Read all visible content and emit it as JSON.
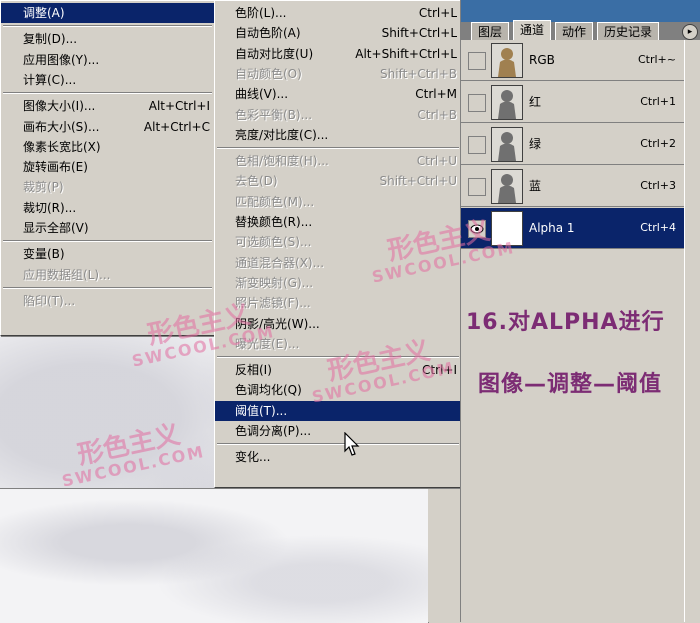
{
  "menu1": {
    "items": [
      {
        "label": "调整(A)",
        "shortcut": "",
        "disabled": false,
        "highlighted": true
      },
      {
        "sep": true
      },
      {
        "label": "复制(D)...",
        "shortcut": "",
        "disabled": false
      },
      {
        "label": "应用图像(Y)...",
        "shortcut": "",
        "disabled": false
      },
      {
        "label": "计算(C)...",
        "shortcut": "",
        "disabled": false
      },
      {
        "sep": true
      },
      {
        "label": "图像大小(I)...",
        "shortcut": "Alt+Ctrl+I",
        "disabled": false
      },
      {
        "label": "画布大小(S)...",
        "shortcut": "Alt+Ctrl+C",
        "disabled": false
      },
      {
        "label": "像素长宽比(X)",
        "shortcut": "",
        "disabled": false
      },
      {
        "label": "旋转画布(E)",
        "shortcut": "",
        "disabled": false
      },
      {
        "label": "裁剪(P)",
        "shortcut": "",
        "disabled": true
      },
      {
        "label": "裁切(R)...",
        "shortcut": "",
        "disabled": false
      },
      {
        "label": "显示全部(V)",
        "shortcut": "",
        "disabled": false
      },
      {
        "sep": true
      },
      {
        "label": "变量(B)",
        "shortcut": "",
        "disabled": false
      },
      {
        "label": "应用数据组(L)...",
        "shortcut": "",
        "disabled": true
      },
      {
        "sep": true
      },
      {
        "label": "陷印(T)...",
        "shortcut": "",
        "disabled": true
      }
    ]
  },
  "menu2": {
    "items": [
      {
        "label": "色阶(L)...",
        "shortcut": "Ctrl+L",
        "disabled": false
      },
      {
        "label": "自动色阶(A)",
        "shortcut": "Shift+Ctrl+L",
        "disabled": false
      },
      {
        "label": "自动对比度(U)",
        "shortcut": "Alt+Shift+Ctrl+L",
        "disabled": false
      },
      {
        "label": "自动颜色(O)",
        "shortcut": "Shift+Ctrl+B",
        "disabled": true
      },
      {
        "label": "曲线(V)...",
        "shortcut": "Ctrl+M",
        "disabled": false
      },
      {
        "label": "色彩平衡(B)...",
        "shortcut": "Ctrl+B",
        "disabled": true
      },
      {
        "label": "亮度/对比度(C)...",
        "shortcut": "",
        "disabled": false
      },
      {
        "sep": true
      },
      {
        "label": "色相/饱和度(H)...",
        "shortcut": "Ctrl+U",
        "disabled": true
      },
      {
        "label": "去色(D)",
        "shortcut": "Shift+Ctrl+U",
        "disabled": true
      },
      {
        "label": "匹配颜色(M)...",
        "shortcut": "",
        "disabled": true
      },
      {
        "label": "替换颜色(R)...",
        "shortcut": "",
        "disabled": false
      },
      {
        "label": "可选颜色(S)...",
        "shortcut": "",
        "disabled": true
      },
      {
        "label": "通道混合器(X)...",
        "shortcut": "",
        "disabled": true
      },
      {
        "label": "渐变映射(G)...",
        "shortcut": "",
        "disabled": true
      },
      {
        "label": "照片滤镜(F)...",
        "shortcut": "",
        "disabled": true
      },
      {
        "label": "阴影/高光(W)...",
        "shortcut": "",
        "disabled": false
      },
      {
        "label": "曝光度(E)...",
        "shortcut": "",
        "disabled": true
      },
      {
        "sep": true
      },
      {
        "label": "反相(I)",
        "shortcut": "Ctrl+I",
        "disabled": false
      },
      {
        "label": "色调均化(Q)",
        "shortcut": "",
        "disabled": false
      },
      {
        "label": "阈值(T)...",
        "shortcut": "",
        "disabled": false,
        "highlighted": true
      },
      {
        "label": "色调分离(P)...",
        "shortcut": "",
        "disabled": false
      },
      {
        "sep": true
      },
      {
        "label": "变化...",
        "shortcut": "",
        "disabled": false
      }
    ]
  },
  "panel": {
    "tabs": [
      "图层",
      "通道",
      "动作",
      "历史记录"
    ],
    "active_tab": 1,
    "menu_icon": "▸",
    "channels": [
      {
        "name": "RGB",
        "shortcut": "Ctrl+~",
        "selected": false
      },
      {
        "name": "红",
        "shortcut": "Ctrl+1",
        "selected": false
      },
      {
        "name": "绿",
        "shortcut": "Ctrl+2",
        "selected": false
      },
      {
        "name": "蓝",
        "shortcut": "Ctrl+3",
        "selected": false
      },
      {
        "name": "Alpha 1",
        "shortcut": "Ctrl+4",
        "selected": true
      }
    ]
  },
  "annotation": {
    "line1": "16.对ALPHA进行",
    "line2": "图像—调整—阈值"
  },
  "watermark": {
    "text1": "形色主义",
    "text2": "SWCOOL.COM"
  },
  "colors": {
    "menu_bg": "#d4d0c8",
    "highlight": "#0a246a",
    "annotation": "#7c2c74",
    "watermark": "#e06ea0"
  }
}
